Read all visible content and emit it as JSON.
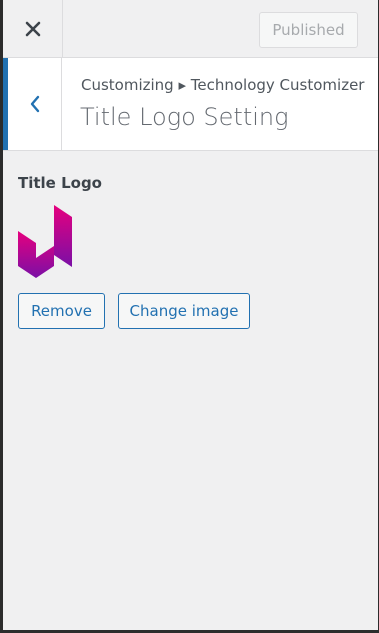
{
  "header": {
    "close_icon": "close-icon",
    "publish_label": "Published"
  },
  "section": {
    "back_icon": "chevron-left-icon",
    "breadcrumb": "Customizing ▸ Technology Customizer",
    "title": "Title Logo Setting"
  },
  "control": {
    "label": "Title Logo",
    "logo_colors": {
      "top": "#e6007e",
      "bottom": "#7a0fa6"
    },
    "remove_label": "Remove",
    "change_label": "Change image"
  },
  "colors": {
    "accent": "#2271b1",
    "background": "#f0f0f1"
  }
}
